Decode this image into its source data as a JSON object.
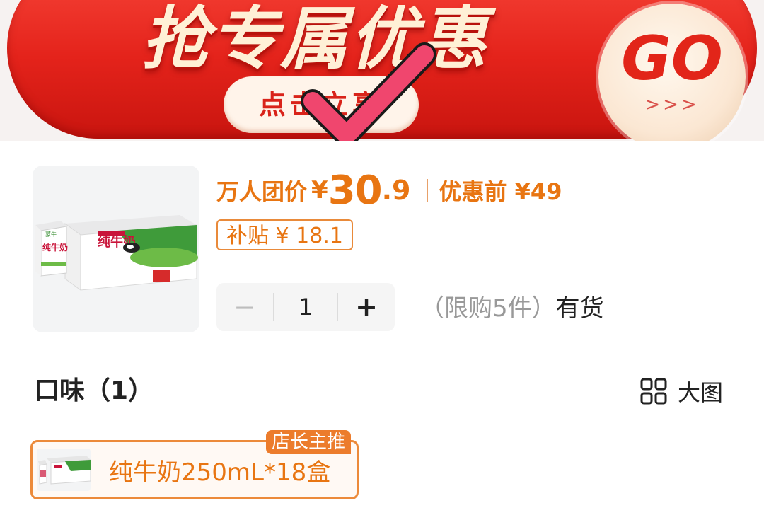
{
  "banner": {
    "title": "抢专属优惠",
    "subtitle": "点击立享",
    "go_label": "GO",
    "go_arrows": ">>>"
  },
  "product": {
    "price_label": "万人团价",
    "currency": "¥",
    "price_integer": "30",
    "price_decimal": ".9",
    "original_price": "优惠前 ¥49",
    "subsidy": "补贴 ¥ 18.1",
    "package": {
      "brand": "蒙牛",
      "name": "纯牛奶"
    }
  },
  "quantity": {
    "minus": "−",
    "value": "1",
    "plus": "+",
    "limit": "（限购5件）",
    "stock": "有货"
  },
  "flavor": {
    "title": "口味（1）",
    "big_view_label": "大图",
    "option_label": "纯牛奶250mL*18盒",
    "option_badge": "店长主推"
  },
  "colors": {
    "accent": "#e87512",
    "banner_red": "#e4231b",
    "check_pink": "#f0466e",
    "badge": "#ec7c2c"
  }
}
